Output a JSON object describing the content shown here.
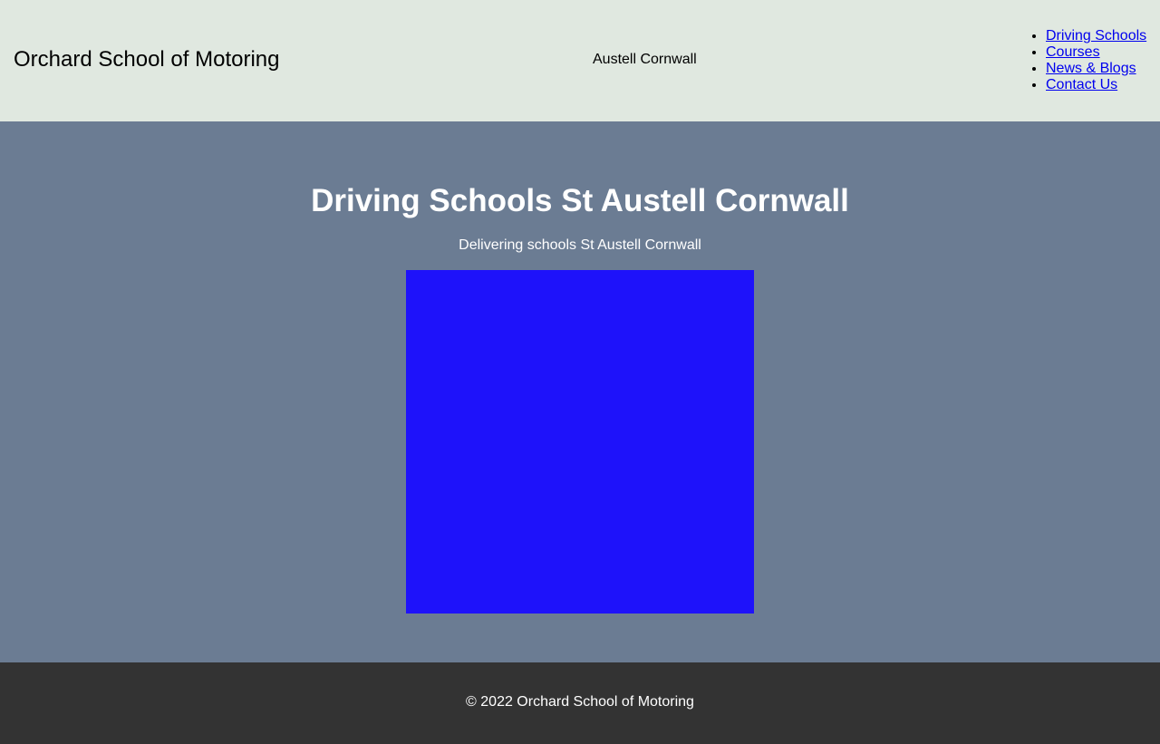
{
  "header": {
    "brand": "Orchard School of Motoring",
    "location": "Austell Cornwall",
    "nav": [
      {
        "label": "Driving Schools"
      },
      {
        "label": "Courses"
      },
      {
        "label": "News & Blogs"
      },
      {
        "label": "Contact Us"
      }
    ]
  },
  "hero": {
    "title": "Driving Schools St Austell Cornwall",
    "subtitle": "Delivering schools St Austell Cornwall",
    "image_color": "#1e12fa"
  },
  "footer": {
    "copyright": "© 2022 Orchard School of Motoring"
  },
  "colors": {
    "header_bg": "#e0e8e0",
    "hero_bg": "#6b7c93",
    "footer_bg": "#333333",
    "link": "#0000ee"
  }
}
